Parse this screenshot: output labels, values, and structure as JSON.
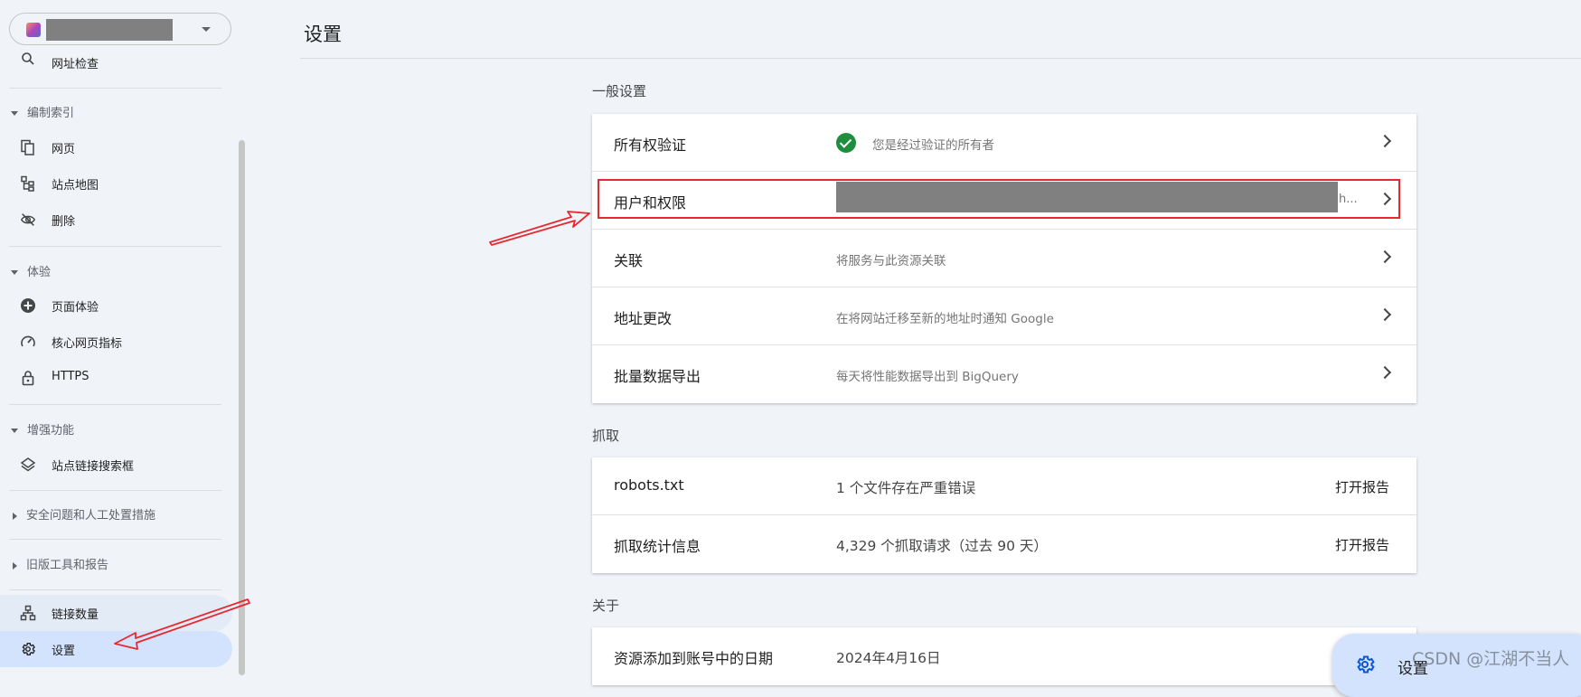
{
  "sidebar": {
    "property_name": "",
    "items": {
      "url_inspection": "网址检查",
      "pages": "网页",
      "sitemaps": "站点地图",
      "removals": "删除",
      "page_experience": "页面体验",
      "core_web_vitals": "核心网页指标",
      "https": "HTTPS",
      "sitelinks_searchbox": "站点链接搜索框",
      "links": "链接数量",
      "settings": "设置"
    },
    "sections": {
      "indexing": "编制索引",
      "experience": "体验",
      "enhancements": "增强功能",
      "security": "安全问题和人工处置措施",
      "legacy": "旧版工具和报告"
    }
  },
  "header": {
    "title": "设置"
  },
  "general": {
    "title": "一般设置",
    "rows": [
      {
        "label": "所有权验证",
        "value": "您是经过验证的所有者"
      },
      {
        "label": "用户和权限",
        "value": "h..."
      },
      {
        "label": "关联",
        "value": "将服务与此资源关联"
      },
      {
        "label": "地址更改",
        "value": "在将网站迁移至新的地址时通知 Google"
      },
      {
        "label": "批量数据导出",
        "value": "每天将性能数据导出到 BigQuery"
      }
    ]
  },
  "crawling": {
    "title": "抓取",
    "rows": [
      {
        "label": "robots.txt",
        "value": "1 个文件存在严重错误",
        "action": "打开报告"
      },
      {
        "label": "抓取统计信息",
        "value": "4,329 个抓取请求（过去 90 天）",
        "action": "打开报告"
      }
    ]
  },
  "about": {
    "title": "关于",
    "rows": [
      {
        "label": "资源添加到账号中的日期",
        "value": "2024年4月16日"
      }
    ]
  },
  "floating_chip": {
    "label": "设置"
  },
  "watermark": "CSDN @江湖不当人",
  "colors": {
    "background": "#f0f4f9",
    "active_nav": "#d3e3fd",
    "verified_green": "#1e8e3e",
    "annotation_red": "#e8282f"
  }
}
